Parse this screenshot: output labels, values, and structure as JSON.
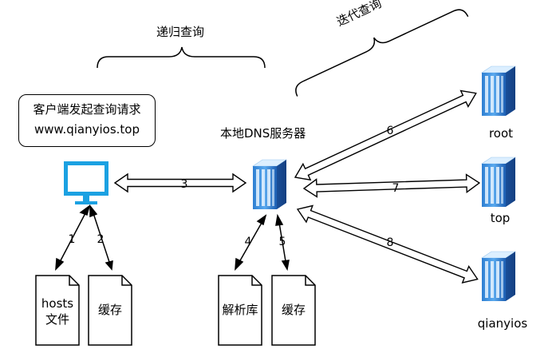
{
  "labels": {
    "recursive": "递归查询",
    "iterative": "迭代查询",
    "local_dns": "本地DNS服务器",
    "root": "root",
    "top": "top",
    "qianyios": "qianyios"
  },
  "note": {
    "line1": "客户端发起查询请求",
    "line2": "www.qianyios.top"
  },
  "documents": {
    "hosts_line1": "hosts",
    "hosts_line2": "文件",
    "cache_client": "缓存",
    "resolver_db": "解析库",
    "cache_server": "缓存"
  },
  "steps": {
    "s1": "1",
    "s2": "2",
    "s3": "3",
    "s4": "4",
    "s5": "5",
    "s6": "6",
    "s7": "7",
    "s8": "8"
  },
  "colors": {
    "monitor": "#1ba1e2",
    "server_light": "#c9e4fb",
    "server_mid": "#3d8fd9",
    "server_dark": "#1b57a8"
  }
}
